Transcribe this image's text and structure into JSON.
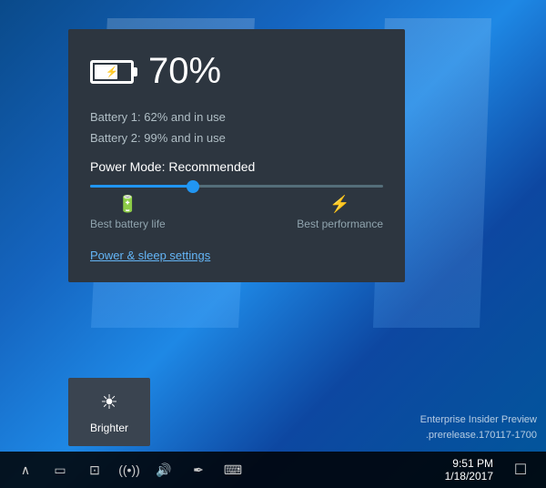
{
  "desktop": {
    "watermark_line1": "Enterprise Insider Preview",
    "watermark_line2": ".prerelease.170117-1700"
  },
  "battery_panel": {
    "percent": "70%",
    "battery1": "Battery 1: 62% and in use",
    "battery2": "Battery 2: 99% and in use",
    "power_mode_label": "Power Mode: Recommended",
    "slider_value": 35,
    "left_label": "Best battery life",
    "right_label": "Best performance",
    "settings_link": "Power & sleep settings"
  },
  "brighter_button": {
    "label": "Brighter"
  },
  "taskbar": {
    "time": "9:51 PM",
    "date": "1/18/2017"
  }
}
